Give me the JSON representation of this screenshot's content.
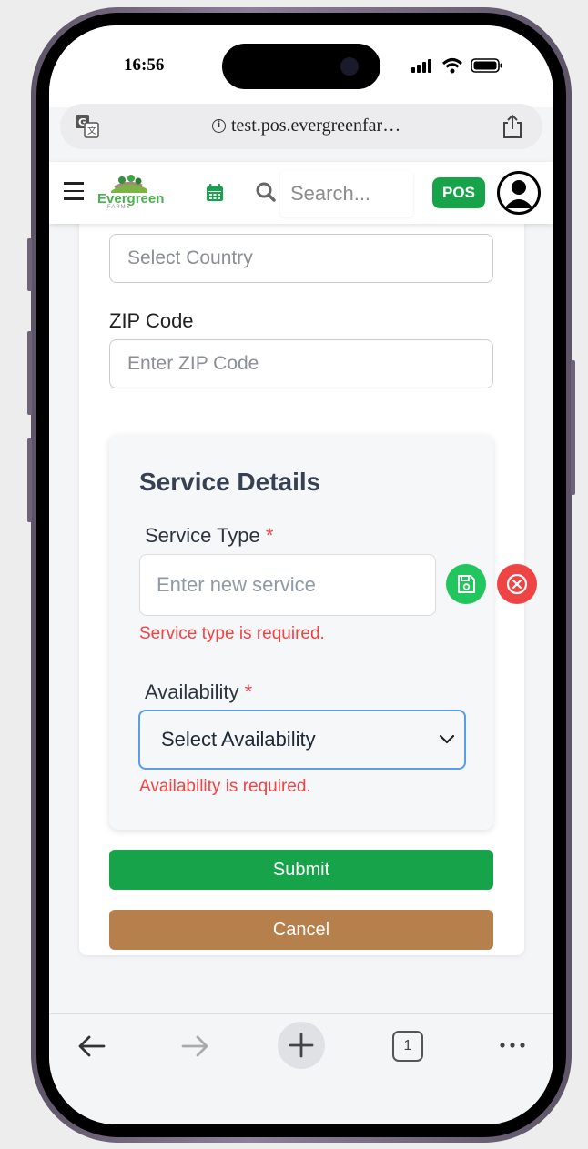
{
  "status_bar": {
    "time": "16:56"
  },
  "browser": {
    "url": "test.pos.evergreenfar…",
    "open_tabs": "1"
  },
  "header": {
    "logo_text": "Evergreen",
    "logo_sub": "FARMS",
    "search_placeholder": "Search...",
    "pos_label": "POS"
  },
  "form": {
    "country_placeholder": "Select Country",
    "zip_label": "ZIP Code",
    "zip_placeholder": "Enter ZIP Code",
    "service_details": {
      "title": "Service Details",
      "service_type_label": "Service Type",
      "required_mark": "*",
      "service_input_placeholder": "Enter new service",
      "service_type_error": "Service type is required.",
      "availability_label": "Availability",
      "availability_value": "Select Availability",
      "availability_error": "Availability is required."
    },
    "submit_label": "Submit",
    "cancel_label": "Cancel"
  },
  "colors": {
    "primary_green": "#16a34a",
    "save_green": "#22c55e",
    "error_red": "#ef4444",
    "cancel_brown": "#b5804c",
    "focus_blue": "#5b9be8"
  }
}
